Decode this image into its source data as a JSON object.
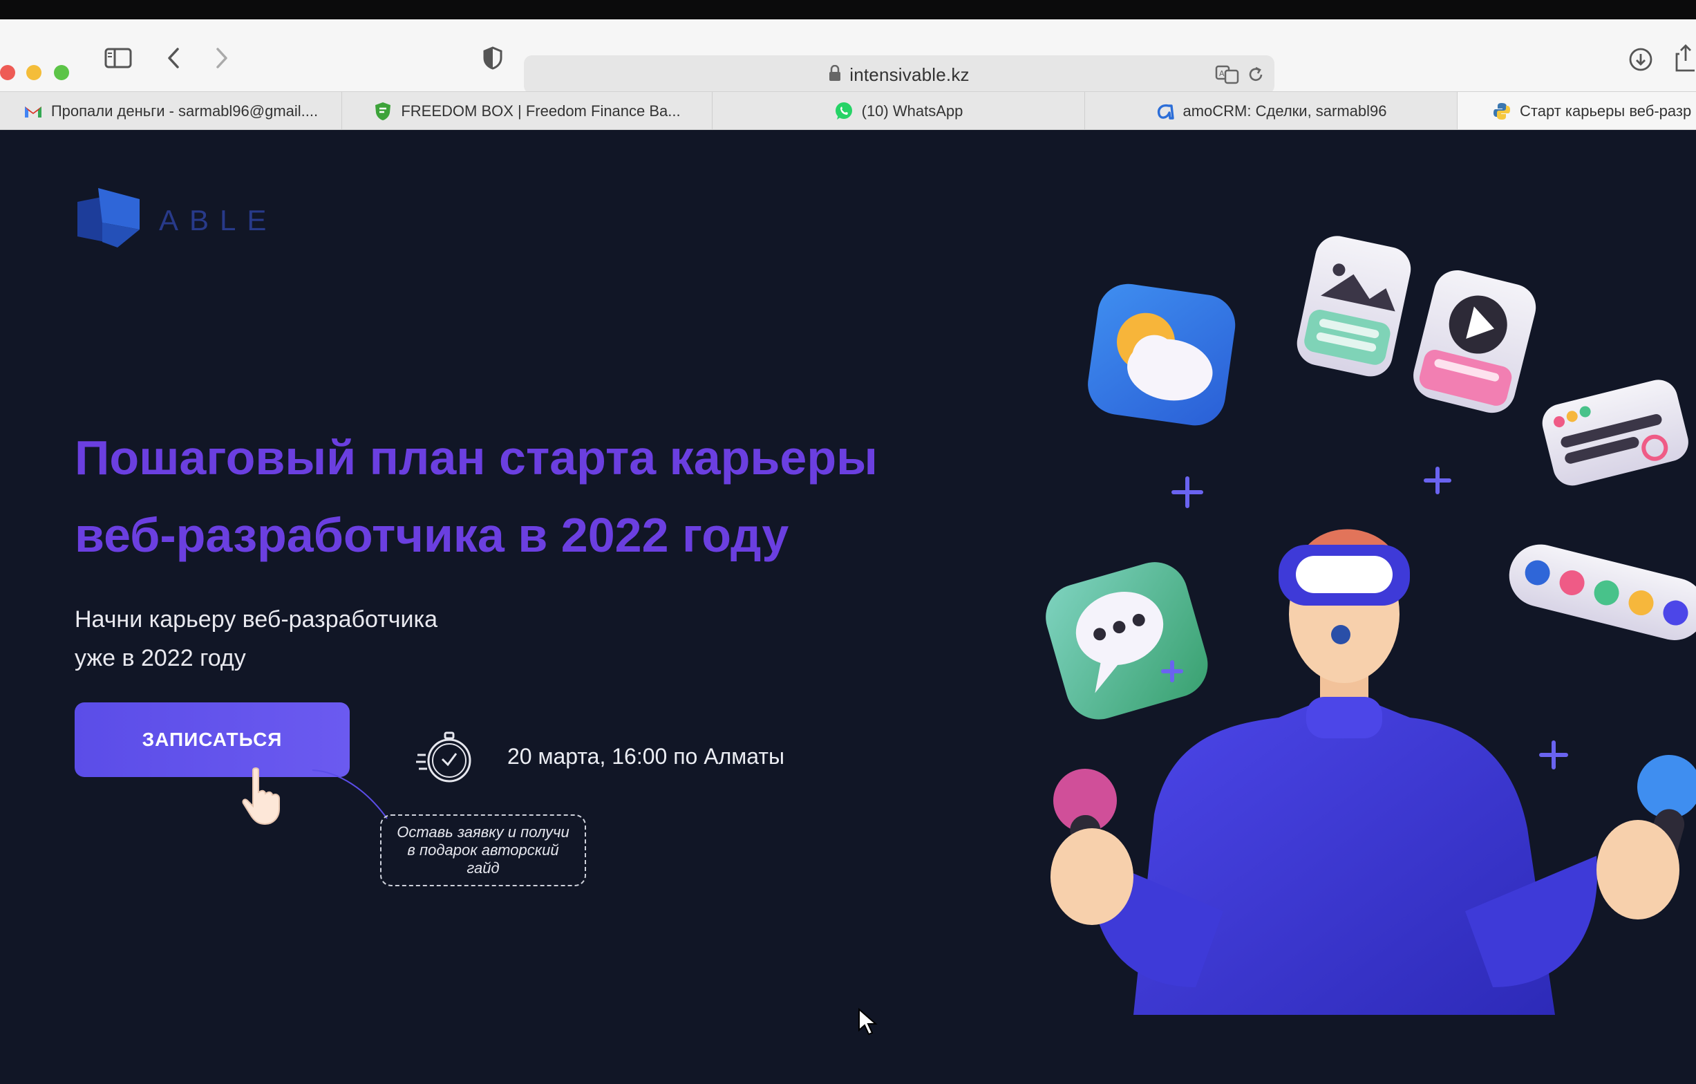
{
  "browser": {
    "url": "intensivable.kz",
    "tabs": [
      {
        "label": "Пропали деньги - sarmabl96@gmail....",
        "icon": "gmail-icon"
      },
      {
        "label": "FREEDOM BOX | Freedom Finance Ba...",
        "icon": "freedom-shield-icon"
      },
      {
        "label": "(10) WhatsApp",
        "icon": "whatsapp-icon"
      },
      {
        "label": "amoCRM: Сделки, sarmabl96",
        "icon": "amocrm-icon"
      },
      {
        "label": "Старт карьеры веб-разр",
        "icon": "python-icon"
      }
    ]
  },
  "page": {
    "logo_text": "ABLE",
    "headline_line1": "Пошаговый план старта карьеры",
    "headline_line2": "веб-разработчика в 2022 году",
    "sub_line1": "Начни карьеру веб-разработчика",
    "sub_line2": "уже в 2022 году",
    "cta_label": "ЗАПИСАТЬСЯ",
    "date_text": "20 марта, 16:00 по Алматы",
    "gift_text": "Оставь заявку и получи в подарок авторский гайд"
  },
  "colors": {
    "page_bg": "#111626",
    "headline": "#6b3fe0",
    "cta": "#5b4de8",
    "logo": "#283a8a"
  }
}
